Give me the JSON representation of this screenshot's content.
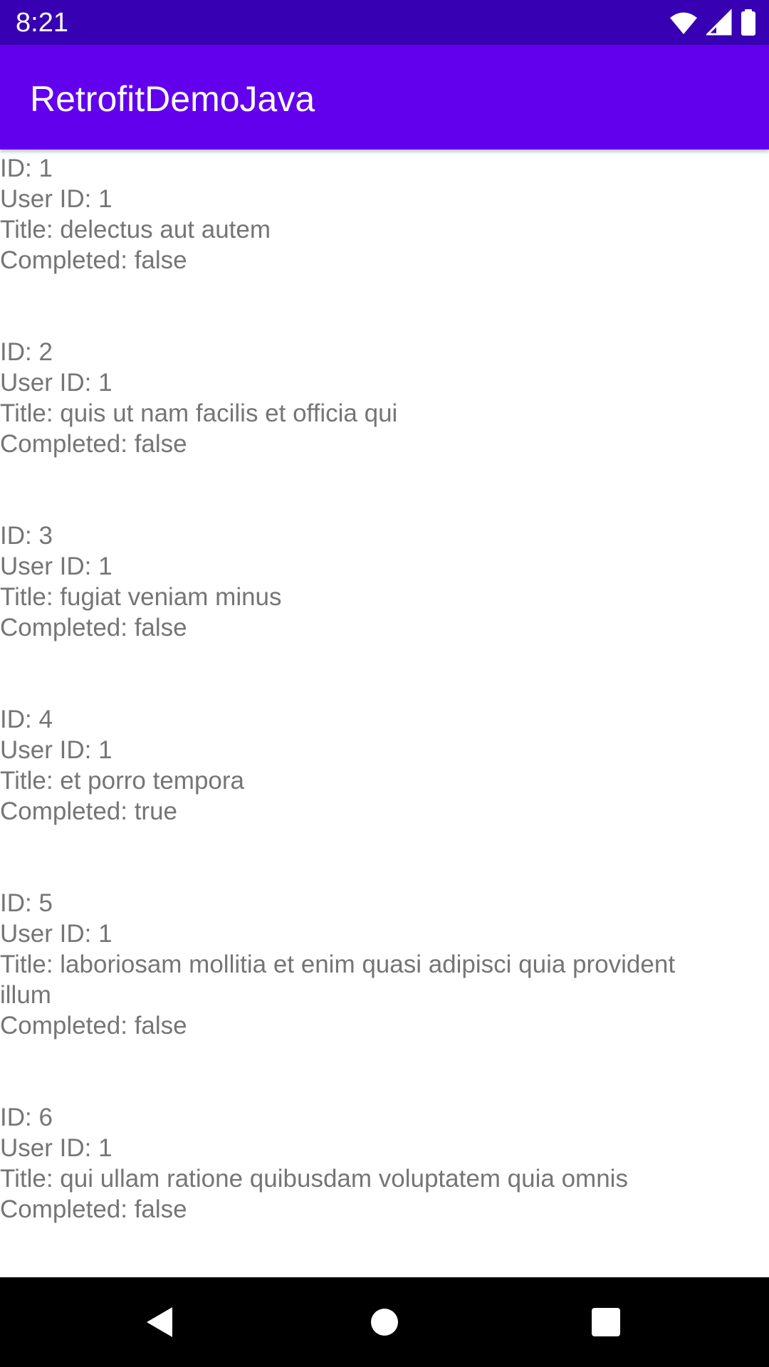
{
  "status_bar": {
    "time": "8:21",
    "icons": [
      "wifi-icon",
      "signal-icon",
      "battery-icon"
    ],
    "background": "#3700B3"
  },
  "app_bar": {
    "title": "RetrofitDemoJava",
    "background": "#6200EE"
  },
  "todos": [
    {
      "id": "ID: 1",
      "user_id": "User ID: 1",
      "title": "Title: delectus aut autem",
      "completed": "Completed: false"
    },
    {
      "id": "ID: 2",
      "user_id": "User ID: 1",
      "title": "Title: quis ut nam facilis et officia qui",
      "completed": "Completed: false"
    },
    {
      "id": "ID: 3",
      "user_id": "User ID: 1",
      "title": "Title: fugiat veniam minus",
      "completed": "Completed: false"
    },
    {
      "id": "ID: 4",
      "user_id": "User ID: 1",
      "title": "Title: et porro tempora",
      "completed": "Completed: true"
    },
    {
      "id": "ID: 5",
      "user_id": "User ID: 1",
      "title": "Title: laboriosam mollitia et enim quasi adipisci quia provident illum",
      "completed": "Completed: false"
    },
    {
      "id": "ID: 6",
      "user_id": "User ID: 1",
      "title": "Title: qui ullam ratione quibusdam voluptatem quia omnis",
      "completed": "Completed: false"
    }
  ],
  "nav_bar": {
    "buttons": [
      "back-icon",
      "home-icon",
      "recents-icon"
    ]
  },
  "colors": {
    "text": "#757575"
  }
}
